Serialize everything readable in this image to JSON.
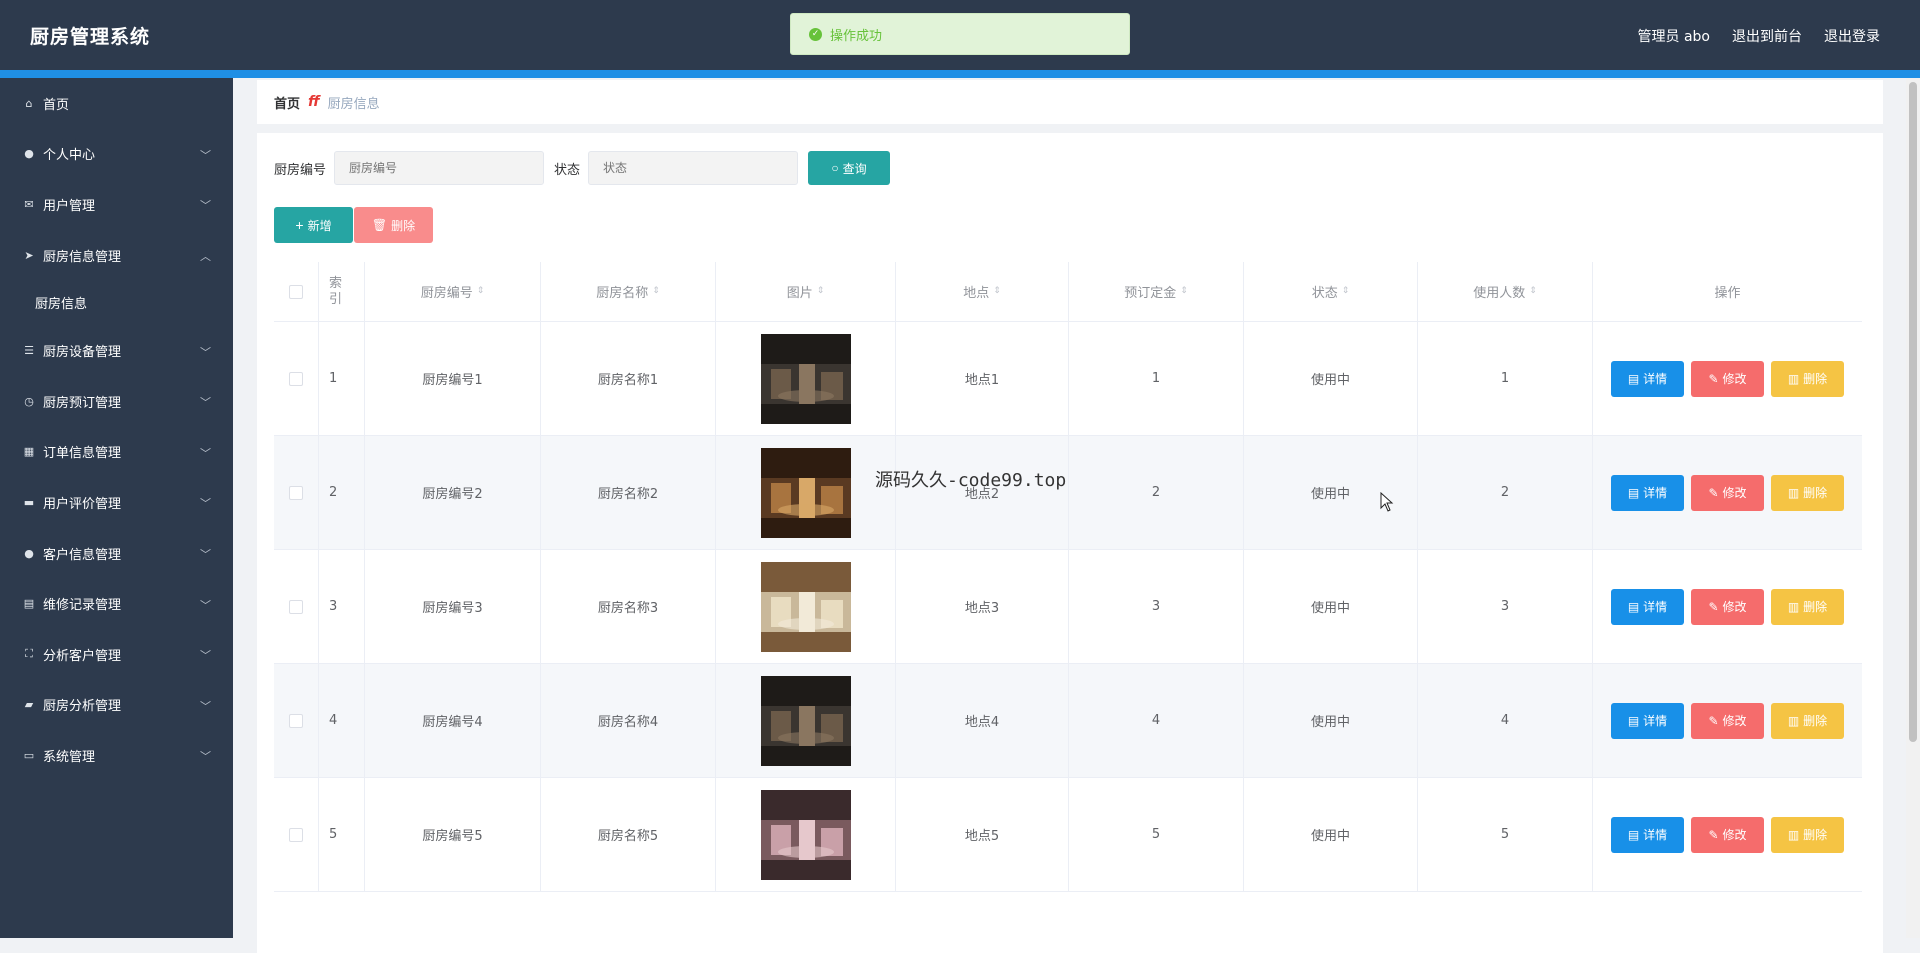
{
  "app": {
    "title": "厨房管理系统"
  },
  "header": {
    "user": "管理员 abo",
    "to_front": "退出到前台",
    "logout": "退出登录"
  },
  "toast": {
    "text": "操作成功"
  },
  "sidebar": {
    "items": [
      {
        "label": "首页",
        "icon": "home-icon",
        "glyph": "⌂"
      },
      {
        "label": "个人中心",
        "icon": "user-icon",
        "glyph": "●"
      },
      {
        "label": "用户管理",
        "icon": "mail-icon",
        "glyph": "✉"
      },
      {
        "label": "厨房信息管理",
        "icon": "send-icon",
        "glyph": "➤"
      },
      {
        "label": "厨房信息",
        "sub": true
      },
      {
        "label": "厨房设备管理",
        "icon": "list-icon",
        "glyph": "☰"
      },
      {
        "label": "厨房预订管理",
        "icon": "clock-icon",
        "glyph": "◷"
      },
      {
        "label": "订单信息管理",
        "icon": "grid-icon",
        "glyph": "▦"
      },
      {
        "label": "用户评价管理",
        "icon": "monitor-icon",
        "glyph": "▬"
      },
      {
        "label": "客户信息管理",
        "icon": "user-icon",
        "glyph": "●"
      },
      {
        "label": "维修记录管理",
        "icon": "clipboard-icon",
        "glyph": "▤"
      },
      {
        "label": "分析客户管理",
        "icon": "fullscreen-icon",
        "glyph": "⛶"
      },
      {
        "label": "厨房分析管理",
        "icon": "chat-icon",
        "glyph": "▰"
      },
      {
        "label": "系统管理",
        "icon": "ticket-icon",
        "glyph": "▭"
      }
    ]
  },
  "breadcrumb": {
    "home": "首页",
    "sep": "ff",
    "current": "厨房信息"
  },
  "search": {
    "code_label": "厨房编号",
    "code_placeholder": "厨房编号",
    "status_label": "状态",
    "status_placeholder": "状态",
    "button": "查询"
  },
  "toolbar": {
    "add": "新增",
    "delete": "删除"
  },
  "table": {
    "headers": {
      "index": "索\n引",
      "code": "厨房编号",
      "name": "厨房名称",
      "picture": "图片",
      "location": "地点",
      "deposit": "预订定金",
      "status": "状态",
      "users": "使用人数",
      "ops": "操作"
    },
    "rows": [
      {
        "index": "1",
        "code": "厨房编号1",
        "name": "厨房名称1",
        "location": "地点1",
        "deposit": "1",
        "status": "使用中",
        "users": "1",
        "img": "dark"
      },
      {
        "index": "2",
        "code": "厨房编号2",
        "name": "厨房名称2",
        "location": "地点2",
        "deposit": "2",
        "status": "使用中",
        "users": "2",
        "img": "wood"
      },
      {
        "index": "3",
        "code": "厨房编号3",
        "name": "厨房名称3",
        "location": "地点3",
        "deposit": "3",
        "status": "使用中",
        "users": "3",
        "img": "round"
      },
      {
        "index": "4",
        "code": "厨房编号4",
        "name": "厨房名称4",
        "location": "地点4",
        "deposit": "4",
        "status": "使用中",
        "users": "4",
        "img": "dark"
      },
      {
        "index": "5",
        "code": "厨房编号5",
        "name": "厨房名称5",
        "location": "地点5",
        "deposit": "5",
        "status": "使用中",
        "users": "5",
        "img": "pink"
      }
    ],
    "row_buttons": {
      "detail": "详情",
      "edit": "修改",
      "remove": "删除"
    }
  },
  "overlay_text": "源码久久-code99.top",
  "colors": {
    "header": "#2d3a4d",
    "accent_strip": "#1f8fe5",
    "teal": "#26a5a3",
    "detail": "#1890e8",
    "edit": "#f56c6c",
    "remove": "#f5c444"
  }
}
